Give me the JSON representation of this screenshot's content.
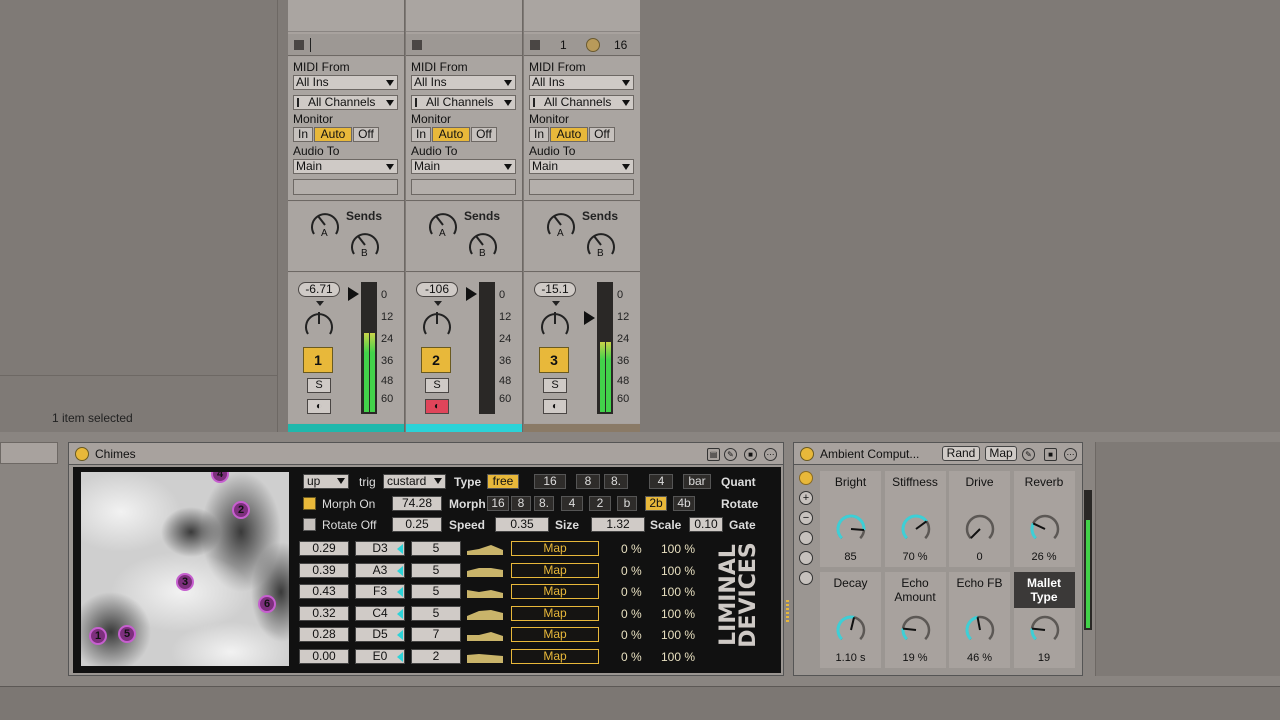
{
  "status": {
    "selection": "1 item selected"
  },
  "tracks": [
    {
      "clip_stop": {
        "show_numbers": false,
        "a": "",
        "b": ""
      },
      "midi_from_label": "MIDI From",
      "midi_from": "All Ins",
      "channels": "All Channels",
      "monitor_label": "Monitor",
      "monitor": [
        "In",
        "Auto",
        "Off"
      ],
      "monitor_active": "Auto",
      "audio_to_label": "Audio To",
      "audio_to": "Main",
      "sends_label": "Sends",
      "send_a": "A",
      "send_b": "B",
      "volume": "-6.71",
      "number": "1",
      "solo": "S",
      "arm_color": "#cfcac6",
      "meter": 0.62,
      "strip_color": "#1fb8ac"
    },
    {
      "clip_stop": {
        "show_numbers": false,
        "a": "",
        "b": ""
      },
      "midi_from_label": "MIDI From",
      "midi_from": "All Ins",
      "channels": "All Channels",
      "monitor_label": "Monitor",
      "monitor": [
        "In",
        "Auto",
        "Off"
      ],
      "monitor_active": "Auto",
      "audio_to_label": "Audio To",
      "audio_to": "Main",
      "sends_label": "Sends",
      "send_a": "A",
      "send_b": "B",
      "volume": "-106",
      "number": "2",
      "solo": "S",
      "arm_color": "#e0455a",
      "meter": 0.0,
      "strip_color": "#2bd3d8"
    },
    {
      "clip_stop": {
        "show_numbers": true,
        "a": "1",
        "b": "16"
      },
      "midi_from_label": "MIDI From",
      "midi_from": "All Ins",
      "channels": "All Channels",
      "monitor_label": "Monitor",
      "monitor": [
        "In",
        "Auto",
        "Off"
      ],
      "monitor_active": "Auto",
      "audio_to_label": "Audio To",
      "audio_to": "Main",
      "sends_label": "Sends",
      "send_a": "A",
      "send_b": "B",
      "volume": "-15.1",
      "number": "3",
      "solo": "S",
      "arm_color": "#cfcac6",
      "meter": 0.55,
      "strip_color": "#8a7a66"
    }
  ],
  "meter_scale": [
    "0",
    "12",
    "24",
    "36",
    "48",
    "60"
  ],
  "chimes": {
    "title": "Chimes",
    "points": [
      "4",
      "2",
      "3",
      "6",
      "1",
      "5"
    ],
    "direction": "up",
    "trig_label": "trig",
    "trig": "custard",
    "type_label": "Type",
    "type_options": [
      "free",
      "16",
      "8",
      "8.",
      "4",
      "bar"
    ],
    "type_active": "free",
    "quant_label": "Quant",
    "morph_on": "Morph On",
    "morph_value": "74.28",
    "morph_label": "Morph",
    "rotate_options": [
      "16",
      "8",
      "8.",
      "4",
      "2",
      "b",
      "2b",
      "4b"
    ],
    "rotate_active": "2b",
    "rotate_label": "Rotate",
    "rotate_off": "Rotate Off",
    "rotate_value": "0.25",
    "speed_label": "Speed",
    "size_value": "0.35",
    "size_label": "Size",
    "scale_value": "1.32",
    "scale_label": "Scale",
    "gate_value": "0.10",
    "gate_label": "Gate",
    "rows": [
      {
        "v": "0.29",
        "note": "D3",
        "n": "5",
        "map": "Map",
        "lo": "0 %",
        "hi": "100 %"
      },
      {
        "v": "0.39",
        "note": "A3",
        "n": "5",
        "map": "Map",
        "lo": "0 %",
        "hi": "100 %"
      },
      {
        "v": "0.43",
        "note": "F3",
        "n": "5",
        "map": "Map",
        "lo": "0 %",
        "hi": "100 %"
      },
      {
        "v": "0.32",
        "note": "C4",
        "n": "5",
        "map": "Map",
        "lo": "0 %",
        "hi": "100 %"
      },
      {
        "v": "0.28",
        "note": "D5",
        "n": "7",
        "map": "Map",
        "lo": "0 %",
        "hi": "100 %"
      },
      {
        "v": "0.00",
        "note": "E0",
        "n": "2",
        "map": "Map",
        "lo": "0 %",
        "hi": "100 %"
      }
    ],
    "brand": "LIMINAL DEVICES"
  },
  "ambient": {
    "title": "Ambient Comput...",
    "rand": "Rand",
    "map": "Map",
    "params": [
      {
        "name": "Bright",
        "value": "85",
        "level": 0.85,
        "highlight": false
      },
      {
        "name": "Stiffness",
        "value": "70 %",
        "level": 0.7,
        "highlight": false
      },
      {
        "name": "Drive",
        "value": "0",
        "level": 0.0,
        "highlight": false
      },
      {
        "name": "Reverb",
        "value": "26 %",
        "level": 0.26,
        "highlight": false
      },
      {
        "name": "Decay",
        "value": "1.10 s",
        "level": 0.55,
        "highlight": false
      },
      {
        "name": "Echo Amount",
        "value": "19 %",
        "level": 0.19,
        "highlight": false
      },
      {
        "name": "Echo FB",
        "value": "46 %",
        "level": 0.46,
        "highlight": false
      },
      {
        "name": "Mallet Type",
        "value": "19",
        "level": 0.19,
        "highlight": true
      }
    ]
  },
  "colors": {
    "accent": "#e8b83a",
    "knob": "#3ecfd6",
    "meter": "#42d24a"
  }
}
